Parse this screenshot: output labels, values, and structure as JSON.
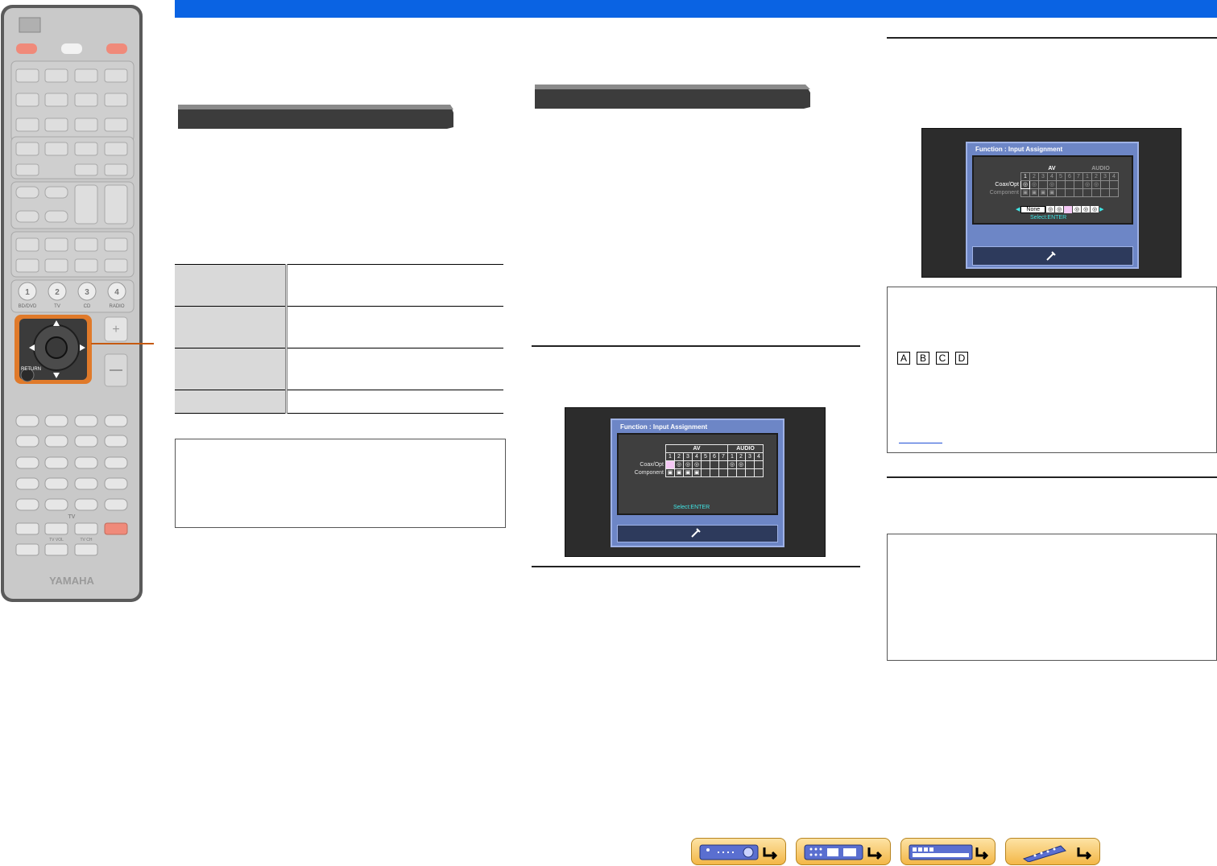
{
  "remote": {
    "brand": "YAMAHA",
    "number_keys": [
      {
        "digit": "1",
        "label": "BD/DVD"
      },
      {
        "digit": "2",
        "label": "TV"
      },
      {
        "digit": "3",
        "label": "CD"
      },
      {
        "digit": "4",
        "label": "RADIO"
      }
    ],
    "return_label": "RETURN",
    "tv_label": "TV",
    "tv_vol_label": "TV VOL",
    "tv_ch_label": "TV CH"
  },
  "osd_screen_1": {
    "title": "Function : Input Assignment",
    "group_av": "AV",
    "group_audio": "AUDIO",
    "av_columns": [
      "1",
      "2",
      "3",
      "4",
      "5",
      "6",
      "7"
    ],
    "audio_columns": [
      "1",
      "2",
      "3",
      "4"
    ],
    "row_labels": [
      "Coax/Opt",
      "Component"
    ],
    "select_hint": "Select:ENTER"
  },
  "osd_screen_2": {
    "title": "Function : Input Assignment",
    "group_av": "AV",
    "group_audio": "AUDIO",
    "av_columns": [
      "1",
      "2",
      "3",
      "4",
      "5",
      "6",
      "7"
    ],
    "audio_columns": [
      "1",
      "2",
      "3",
      "4"
    ],
    "row_labels": [
      "Coax/Opt",
      "Component"
    ],
    "option_value": "None",
    "select_hint": "Select:ENTER"
  },
  "component_letters": [
    "A",
    "B",
    "C",
    "D"
  ],
  "colors": {
    "header_bar": "#0a63e3",
    "osd_panel": "#6d86c6",
    "nav_button": "#f3b747",
    "leader_line": "#c55a11"
  }
}
